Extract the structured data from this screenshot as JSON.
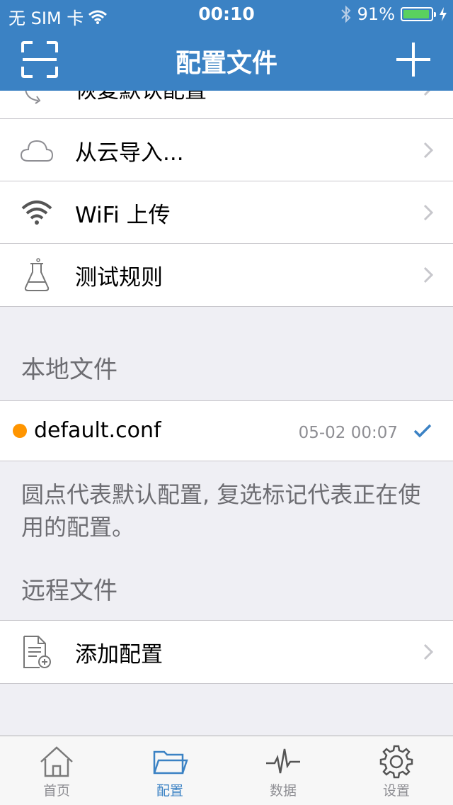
{
  "status_bar": {
    "carrier": "无 SIM 卡",
    "time": "00:10",
    "battery": "91%"
  },
  "nav": {
    "title": "配置文件"
  },
  "menu": {
    "items": [
      {
        "label": "恢复默认配置",
        "icon": "restore-icon"
      },
      {
        "label": "从云导入...",
        "icon": "cloud-icon"
      },
      {
        "label": "WiFi 上传",
        "icon": "wifi-icon"
      },
      {
        "label": "测试规则",
        "icon": "flask-icon"
      }
    ]
  },
  "local": {
    "header": "本地文件",
    "file": {
      "name": "default.conf",
      "date": "05-02 00:07",
      "dot_color": "#ff9500",
      "selected": true
    },
    "note": "圆点代表默认配置, 复选标记代表正在使用的配置。"
  },
  "remote": {
    "header": "远程文件",
    "add_label": "添加配置"
  },
  "tabbar": {
    "active": 1,
    "tabs": [
      {
        "label": "首页",
        "icon": "home-icon"
      },
      {
        "label": "配置",
        "icon": "folder-icon"
      },
      {
        "label": "数据",
        "icon": "pulse-icon"
      },
      {
        "label": "设置",
        "icon": "gear-icon"
      }
    ]
  },
  "colors": {
    "accent": "#3b82c4",
    "orange_dot": "#ff9500",
    "battery_green": "#5ad15e"
  }
}
